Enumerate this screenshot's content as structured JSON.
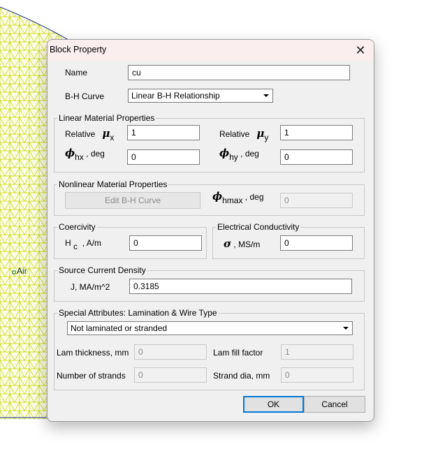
{
  "background": {
    "region_label": "Air"
  },
  "dialog": {
    "title": "Block Property",
    "name_label": "Name",
    "name_value": "cu",
    "bh_label": "B-H Curve",
    "bh_value": "Linear B-H Relationship",
    "linear_group": {
      "label": "Linear Material Properties",
      "mu_prefix": "Relative",
      "mu_symbol": "μ",
      "mu_x_sub": "x",
      "mu_y_sub": "y",
      "mu_x_value": "1",
      "mu_y_value": "1",
      "phi_symbol": "ϕ",
      "phi_hx_sub": "hx",
      "phi_hy_sub": "hy",
      "deg_suffix": ", deg",
      "phi_hx_value": "0",
      "phi_hy_value": "0"
    },
    "nonlinear_group": {
      "label": "Nonlinear Material Properties",
      "edit_button": "Edit B-H Curve",
      "phi_symbol": "ϕ",
      "phi_sub": "hmax",
      "deg_suffix": ", deg",
      "value": "0"
    },
    "coercivity_group": {
      "label": "Coercivity",
      "h_letter": "H",
      "h_sub": "c",
      "unit": ", A/m",
      "value": "0"
    },
    "conductivity_group": {
      "label": "Electrical Conductivity",
      "sigma_symbol": "σ",
      "unit": ", MS/m",
      "value": "0"
    },
    "source_group": {
      "label": "Source Current Density",
      "field_label": "J, MA/m^2",
      "value": "0.3185"
    },
    "special_group": {
      "label": "Special Attributes:  Lamination & Wire Type",
      "type_value": "Not laminated or stranded",
      "lam_thickness_label": "Lam thickness, mm",
      "lam_thickness_value": "0",
      "lam_fill_label": "Lam fill factor",
      "lam_fill_value": "1",
      "strands_label": "Number of strands",
      "strands_value": "0",
      "strand_dia_label": "Strand dia, mm",
      "strand_dia_value": "0"
    },
    "ok_button": "OK",
    "cancel_button": "Cancel"
  },
  "colors": {
    "mesh": "#c8d400",
    "boundary": "#1a2a9a",
    "default_button_border": "#0078d7"
  }
}
